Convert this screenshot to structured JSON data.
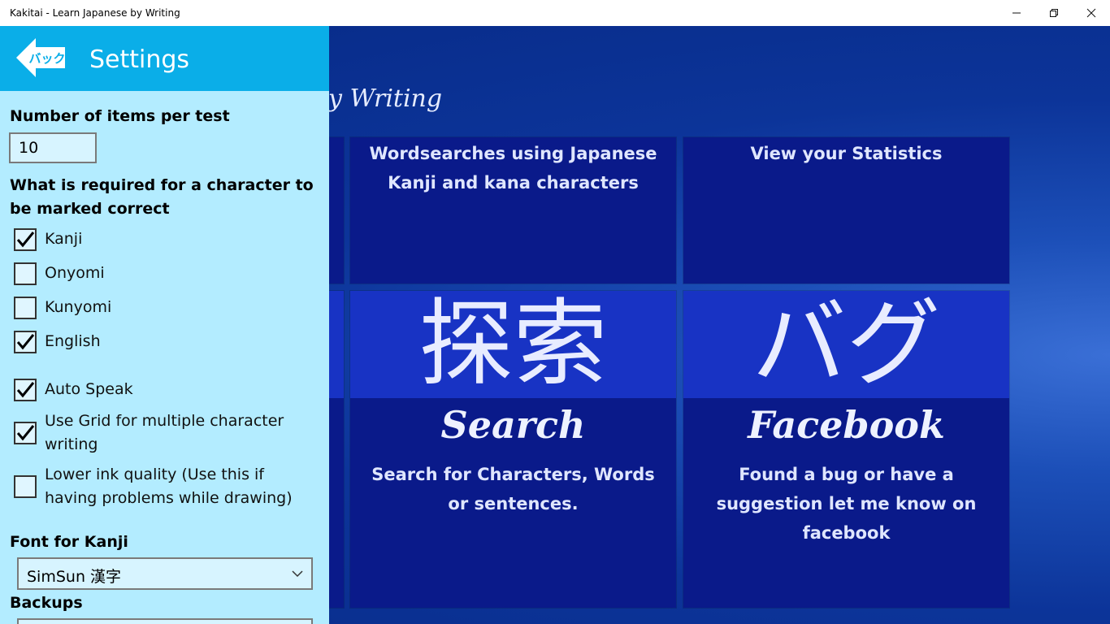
{
  "window": {
    "title": "Kakitai - Learn Japanese by Writing",
    "minimize_icon": "minimize-icon",
    "maximize_icon": "restore-icon",
    "close_icon": "close-icon"
  },
  "background": {
    "app_title_fragment": "y Writing"
  },
  "tiles": {
    "wordsearch": {
      "caption": "Wordsearches using Japanese Kanji and kana characters"
    },
    "statistics": {
      "caption": "View your Statistics"
    },
    "search": {
      "kanji": "探索",
      "title": "Search",
      "caption": "Search for Characters, Words or sentences."
    },
    "facebook": {
      "kana": "バグ",
      "title": "Facebook",
      "caption": "Found a bug or have a suggestion let me know on facebook"
    }
  },
  "settings": {
    "title": "Settings",
    "back_label": "バック",
    "items_label": "Number of items per test",
    "items_value": "10",
    "required_label": "What is required for a character to be marked correct",
    "checks": [
      {
        "label": "Kanji",
        "checked": true
      },
      {
        "label": "Onyomi",
        "checked": false
      },
      {
        "label": "Kunyomi",
        "checked": false
      },
      {
        "label": "English",
        "checked": true
      },
      {
        "label": "Auto Speak",
        "checked": true
      },
      {
        "label": "Use Grid for multiple character writing",
        "checked": true
      },
      {
        "label": "Lower ink quality (Use this if having problems while drawing)",
        "checked": false
      }
    ],
    "font_label": "Font for Kanji",
    "font_value": "SimSun 漢字",
    "backups_label": "Backups"
  },
  "colors": {
    "panel_bg": "#b3ecff",
    "panel_header": "#0aaee8",
    "tile_bg": "#0a1a8a",
    "tile_band": "#1833c4",
    "app_bg": "#0c3499"
  }
}
